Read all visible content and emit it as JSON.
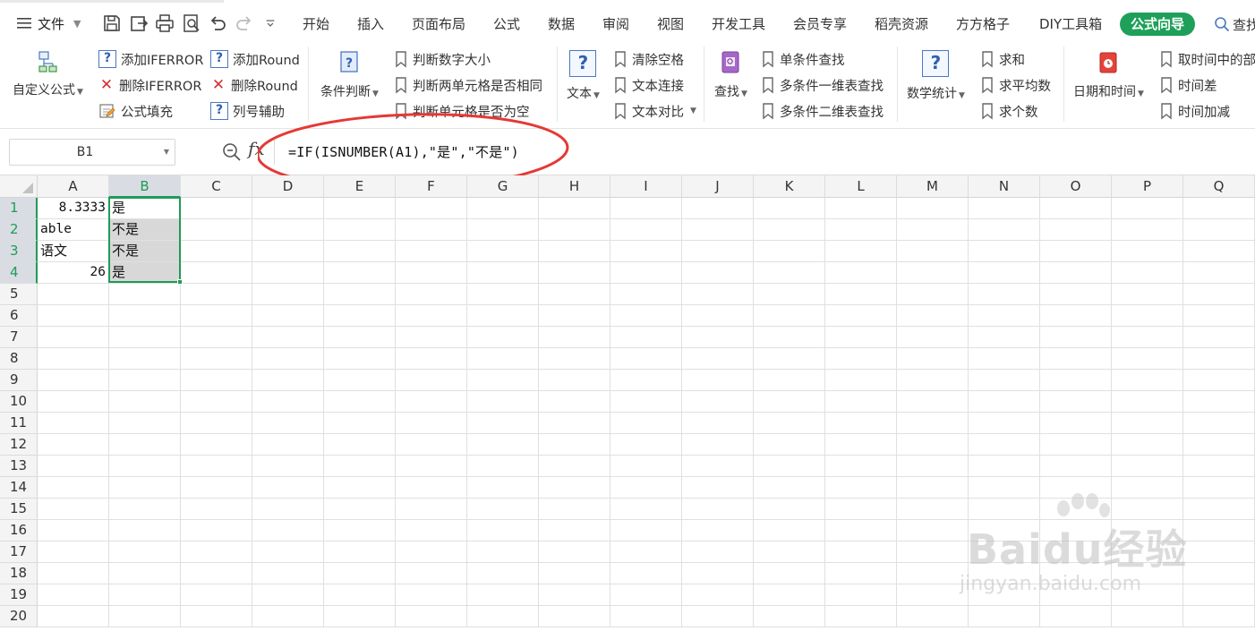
{
  "menubar": {
    "file_label": "文件",
    "tabs": [
      "开始",
      "插入",
      "页面布局",
      "公式",
      "数据",
      "审阅",
      "视图",
      "开发工具",
      "会员专享",
      "稻壳资源",
      "方方格子",
      "DIY工具箱",
      "公式向导"
    ],
    "active_tab": "公式向导",
    "search_label": "查找",
    "accent_color": "#1fa05a"
  },
  "ribbon": {
    "custom_formula": "自定义公式",
    "add_iferror": "添加IFERROR",
    "del_iferror": "删除IFERROR",
    "formula_fill": "公式填充",
    "add_round": "添加Round",
    "del_round": "删除Round",
    "column_helper": "列号辅助",
    "condition_judge": "条件判断",
    "judge_num_size": "判断数字大小",
    "judge_two_same": "判断两单元格是否相同",
    "judge_empty": "判断单元格是否为空",
    "text": "文本",
    "clear_spaces": "清除空格",
    "text_join": "文本连接",
    "text_compare": "文本对比",
    "lookup": "查找",
    "single_lookup": "单条件查找",
    "multi_1d_lookup": "多条件一维表查找",
    "multi_2d_lookup": "多条件二维表查找",
    "math_stats": "数学统计",
    "sum": "求和",
    "average": "求平均数",
    "count": "求个数",
    "datetime": "日期和时间",
    "time_part": "取时间中的部",
    "time_diff": "时间差",
    "time_add": "时间加减"
  },
  "formula_bar": {
    "name_box": "B1",
    "fx": "fx",
    "formula": "=IF(ISNUMBER(A1),\"是\",\"不是\")",
    "annotation_color": "#e53935"
  },
  "sheet": {
    "columns": [
      "A",
      "B",
      "C",
      "D",
      "E",
      "F",
      "G",
      "H",
      "I",
      "J",
      "K",
      "L",
      "M",
      "N",
      "O",
      "P",
      "Q"
    ],
    "rows": [
      "1",
      "2",
      "3",
      "4",
      "5",
      "6",
      "7",
      "8",
      "9",
      "10",
      "11",
      "12",
      "13",
      "14",
      "15",
      "16",
      "17",
      "18",
      "19",
      "20"
    ],
    "a": [
      "8.3333",
      "able",
      "语文",
      "26"
    ],
    "b": [
      "是",
      "不是",
      "不是",
      "是"
    ],
    "selection_color": "#1f9b57"
  },
  "watermark": {
    "brand": "Baidu经验",
    "url": "jingyan.baidu.com"
  }
}
